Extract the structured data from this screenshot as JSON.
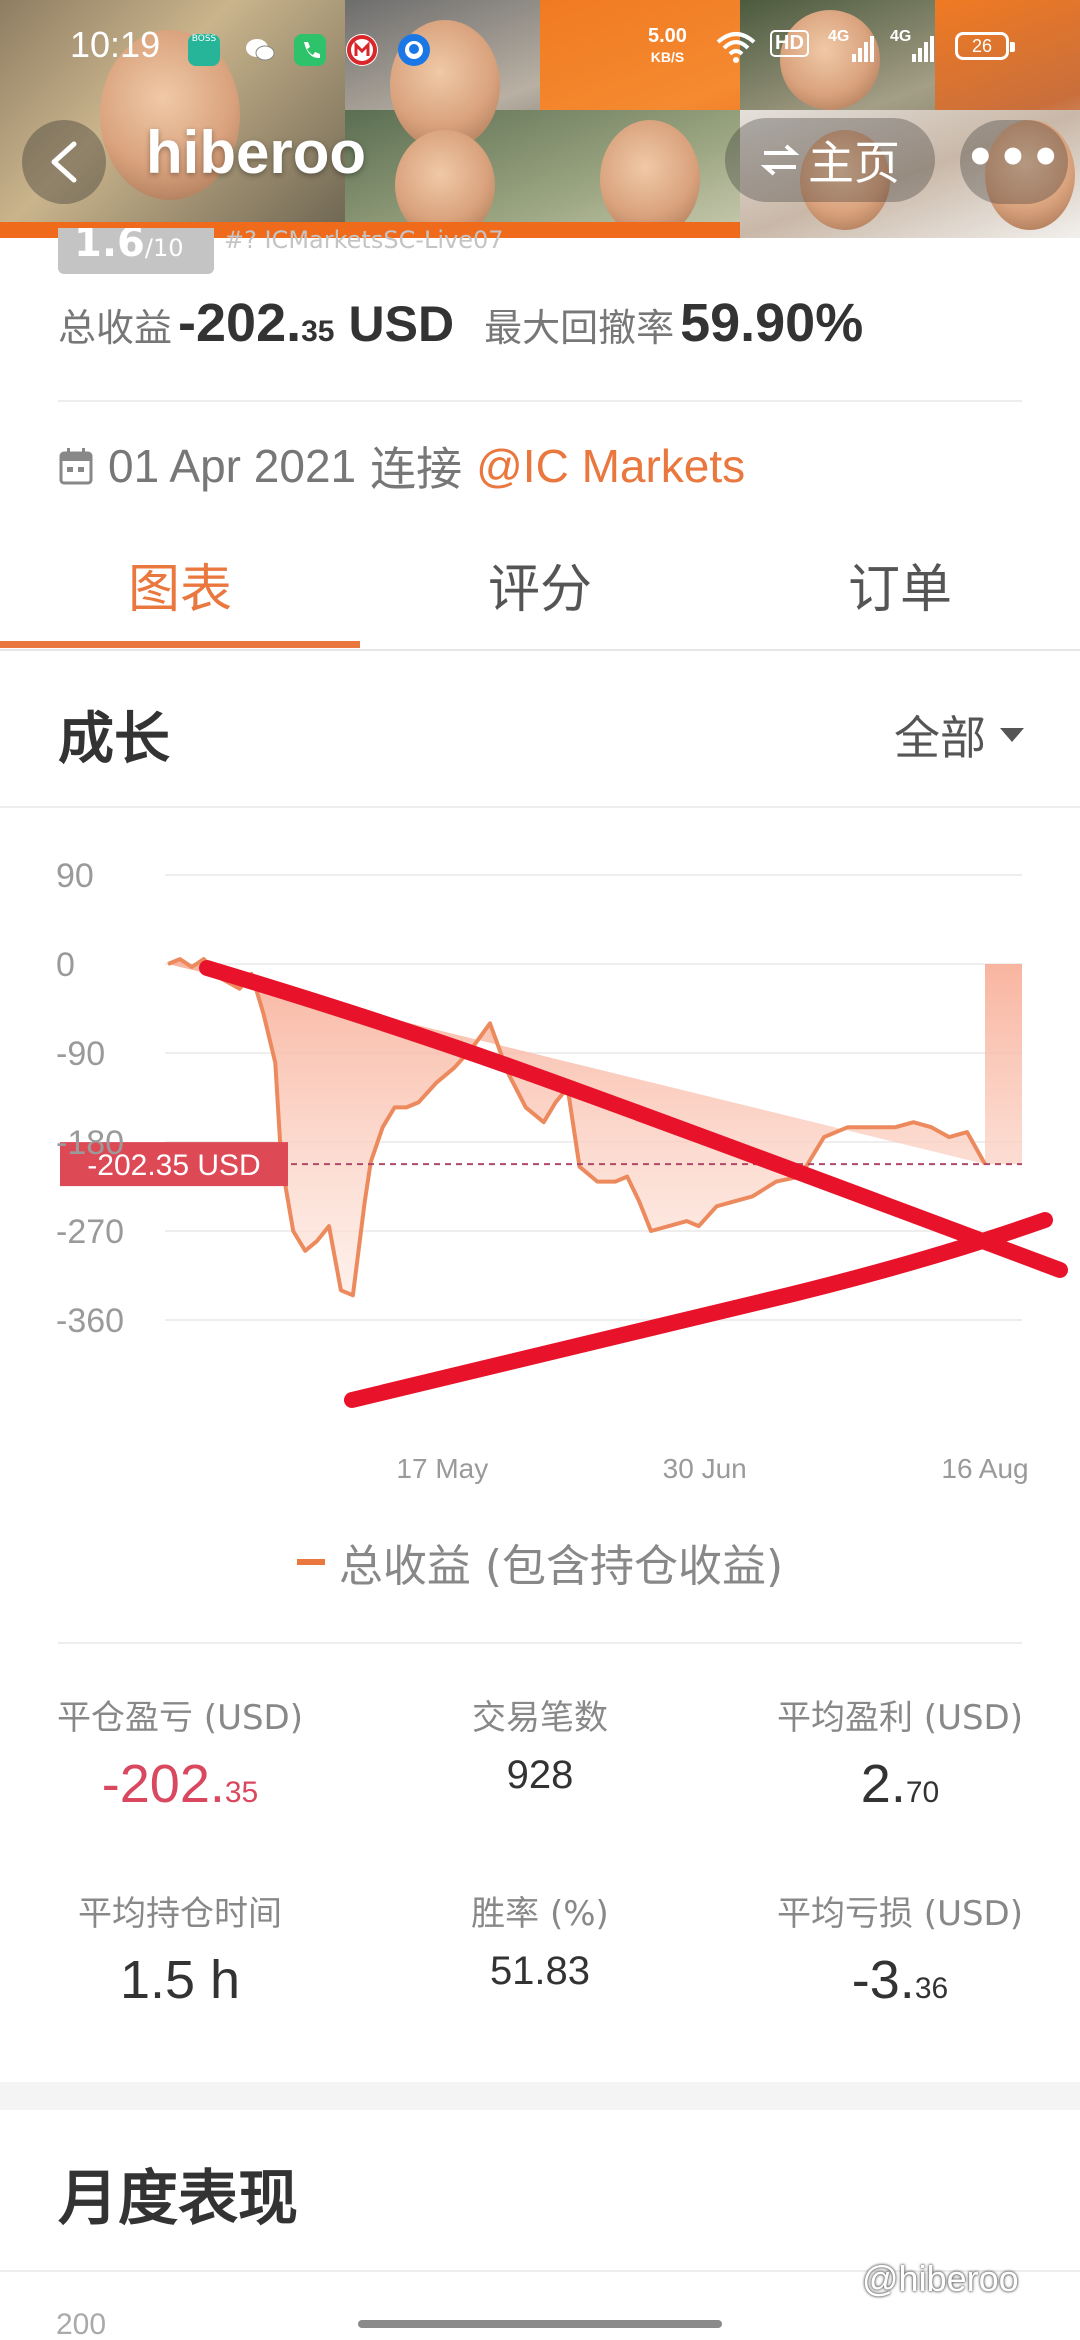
{
  "status_bar": {
    "time": "10:19",
    "net_speed": "5.00",
    "net_unit": "KB/S",
    "hd_label": "HD",
    "signal1": "4G",
    "signal2": "4G",
    "battery": "26",
    "app_icons": [
      "boss-zhipin-icon",
      "wechat-icon",
      "phone-icon",
      "metro-icon",
      "tim-icon"
    ]
  },
  "nav": {
    "title": "hiberoo",
    "home_label": "主页",
    "more_label": "•••"
  },
  "account": {
    "rank": "1.6",
    "rank_total": "/10",
    "server": "#?  ICMarketsSC-Live07"
  },
  "summary": {
    "profit_label": "总收益",
    "profit_main": "-202.",
    "profit_cents": "35",
    "profit_unit": "USD",
    "drawdown_label": "最大回撤率",
    "drawdown_value": "59.90%"
  },
  "connect": {
    "date": "01 Apr 2021",
    "text": "连接",
    "broker": "@IC Markets"
  },
  "tabs": [
    "图表",
    "评分",
    "订单"
  ],
  "growth": {
    "title": "成长",
    "filter": "全部"
  },
  "chart_data": {
    "type": "area",
    "title": "",
    "y_ticks": [
      "90",
      "0",
      "-90",
      "-180",
      "-270",
      "-360"
    ],
    "x_ticks": [
      "17 May",
      "30 Jun",
      "16 Aug"
    ],
    "ylim": [
      -360,
      90
    ],
    "current_value_label": "-202.35 USD",
    "current_value": -202.35,
    "legend": "总收益 (包含持仓收益)",
    "series": [
      {
        "name": "总收益 (包含持仓收益)",
        "x": [
          "01 Apr",
          "03 Apr",
          "05 Apr",
          "07 Apr",
          "10 Apr",
          "13 Apr",
          "15 Apr",
          "17 Apr",
          "19 Apr",
          "20 Apr",
          "22 Apr",
          "24 Apr",
          "26 Apr",
          "28 Apr",
          "30 Apr",
          "02 May",
          "04 May",
          "05 May",
          "07 May",
          "09 May",
          "11 May",
          "13 May",
          "16 May",
          "19 May",
          "22 May",
          "25 May",
          "28 May",
          "31 May",
          "03 Jun",
          "05 Jun",
          "07 Jun",
          "09 Jun",
          "12 Jun",
          "15 Jun",
          "17 Jun",
          "19 Jun",
          "21 Jun",
          "24 Jun",
          "27 Jun",
          "29 Jun",
          "02 Jul",
          "05 Jul",
          "08 Jul",
          "12 Jul",
          "16 Jul",
          "20 Jul",
          "24 Jul",
          "28 Jul",
          "01 Aug",
          "04 Aug",
          "07 Aug",
          "10 Aug",
          "13 Aug",
          "16 Aug"
        ],
        "values": [
          0,
          5,
          -3,
          5,
          -15,
          -25,
          -10,
          -50,
          -100,
          -200,
          -270,
          -290,
          -280,
          -265,
          -330,
          -335,
          -240,
          -200,
          -165,
          -145,
          -145,
          -140,
          -120,
          -105,
          -85,
          -60,
          -110,
          -145,
          -160,
          -140,
          -125,
          -205,
          -220,
          -220,
          -215,
          -240,
          -270,
          -265,
          -260,
          -265,
          -245,
          -240,
          -235,
          -220,
          -215,
          -175,
          -165,
          -165,
          -165,
          -160,
          -165,
          -175,
          -170,
          -202.35
        ]
      }
    ],
    "annotations": [
      "red hand-drawn triangle trend lines"
    ]
  },
  "stats": [
    {
      "label": "平仓盈亏 (USD)",
      "main": "-202.",
      "cents": "35",
      "tone": "neg"
    },
    {
      "label": "交易笔数",
      "main": "928",
      "cents": "",
      "tone": "mid"
    },
    {
      "label": "平均盈利 (USD)",
      "main": "2.",
      "cents": "70",
      "tone": ""
    },
    {
      "label": "平均持仓时间",
      "main": "1.5 h",
      "cents": "",
      "tone": ""
    },
    {
      "label": "胜率 (%)",
      "main": "51.83",
      "cents": "",
      "tone": "mid"
    },
    {
      "label": "平均亏损 (USD)",
      "main": "-3.",
      "cents": "36",
      "tone": ""
    }
  ],
  "monthly": {
    "title": "月度表现",
    "first_tick": "200"
  },
  "watermark": "@hiberoo",
  "colors": {
    "accent": "#e9773e",
    "negative": "#d9485e",
    "marker": "#e8132a",
    "area_top": "#f8b8a0"
  }
}
